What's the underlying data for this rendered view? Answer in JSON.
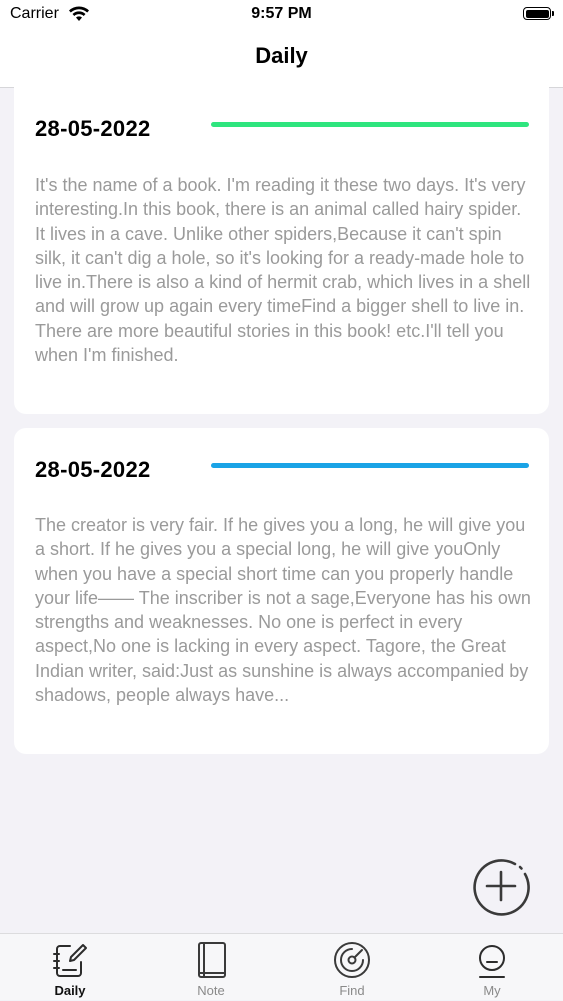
{
  "status_bar": {
    "carrier": "Carrier",
    "time": "9:57 PM"
  },
  "nav": {
    "title": "Daily"
  },
  "entries": [
    {
      "date": "28-05-2022",
      "accent_color": "#2ee57e",
      "text": "It's the name of a book. I'm reading it these two days. It's very interesting.In this book, there is an animal called hairy spider. It lives in a cave. Unlike other spiders,Because it can't spin silk, it can't dig a hole, so it's looking for a ready-made hole to live in.There is also a kind of hermit crab, which lives in a shell and will grow up again every timeFind a bigger shell to live in. There are more beautiful stories in this book! etc.I'll tell you when I'm finished."
    },
    {
      "date": "28-05-2022",
      "accent_color": "#1aa3e6",
      "text": "The creator is very fair. If he gives you a long, he will give you a short. If he gives you a special long, he will give youOnly when you have a special short time can you properly handle your life—— The inscriber is not a sage,Everyone has his own strengths and weaknesses. No one is perfect in every aspect,No one is lacking in every aspect. Tagore, the Great Indian writer, said:Just as sunshine is always accompanied by shadows, people always have..."
    }
  ],
  "fab": {
    "icon": "plus-circle-icon"
  },
  "tabs": [
    {
      "label": "Daily",
      "icon": "pencil-notebook-icon",
      "active": true
    },
    {
      "label": "Note",
      "icon": "notebook-icon",
      "active": false
    },
    {
      "label": "Find",
      "icon": "compass-radar-icon",
      "active": false
    },
    {
      "label": "My",
      "icon": "person-icon",
      "active": false
    }
  ]
}
